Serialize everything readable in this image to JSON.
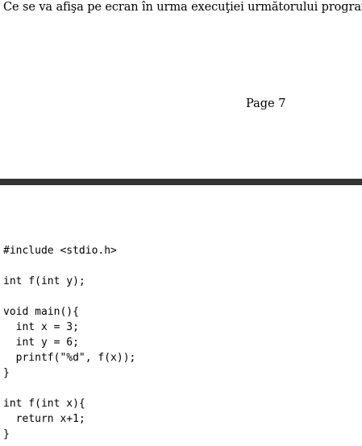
{
  "page": {
    "question": "Ce se va afişa pe ecran în urma execuţiei următorului program?",
    "page_label": "Page 7"
  },
  "code": {
    "lines": [
      "#include <stdio.h>",
      "",
      "int f(int y);",
      "",
      "void main(){",
      "  int x = 3;",
      "  int y = 6;",
      "  printf(\"%d\", f(x));",
      "}",
      "",
      "int f(int x){",
      "  return x+1;",
      "}"
    ]
  }
}
